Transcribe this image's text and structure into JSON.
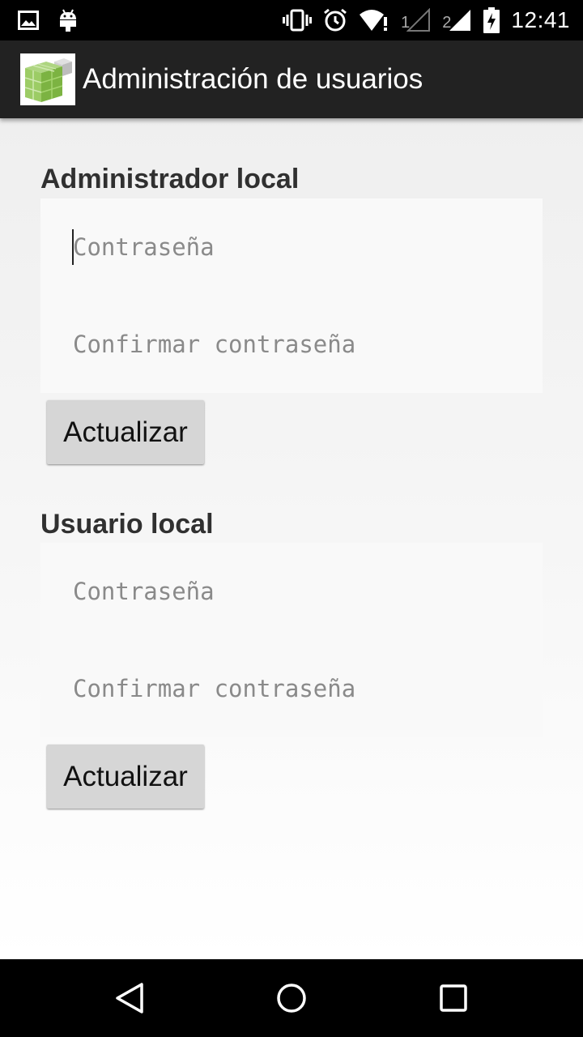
{
  "status_bar": {
    "time": "12:41",
    "sim1_label": "1",
    "sim2_label": "2",
    "icons": [
      "image-icon",
      "android-icon",
      "vibrate-icon",
      "alarm-icon",
      "wifi-icon",
      "signal-icon",
      "battery-charging-icon"
    ]
  },
  "action_bar": {
    "title": "Administración de usuarios",
    "icon": "green-cubes-app-icon"
  },
  "sections": [
    {
      "title": "Administrador local",
      "password_placeholder": "Contraseña",
      "confirm_placeholder": "Confirmar contraseña",
      "button_label": "Actualizar"
    },
    {
      "title": "Usuario local",
      "password_placeholder": "Contraseña",
      "confirm_placeholder": "Confirmar contraseña",
      "button_label": "Actualizar"
    }
  ],
  "nav_bar": {
    "icons": [
      "back-icon",
      "home-icon",
      "recents-icon"
    ]
  },
  "colors": {
    "action_bar": "#222222",
    "button": "#d6d6d6",
    "section_title": "#303030",
    "placeholder": "#8a8a8a",
    "app_icon_green": "#8bc34a"
  }
}
